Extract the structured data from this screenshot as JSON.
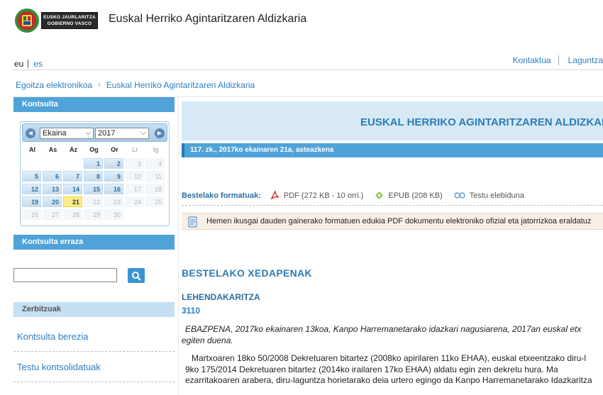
{
  "header": {
    "logo_line1": "EUSKO JAURLARITZA",
    "logo_line2": "GOBIERNO VASCO",
    "site_title": "Euskal Herriko Agintaritzaren Aldizkaria"
  },
  "languages": {
    "current": "eu",
    "other": "es"
  },
  "top_links": {
    "contact": "Kontaktua",
    "help": "Laguntza"
  },
  "breadcrumb": [
    "Egoitza elektronikoa",
    "Euskal Herriko Agintaritzaren Aldizkaria"
  ],
  "sidebar": {
    "consult_header": "Kontsulta",
    "calendar": {
      "month": "Ekaina",
      "year": "2017",
      "weekdays": [
        "Al",
        "As",
        "Az",
        "Og",
        "Or",
        "Lr",
        "Ig"
      ],
      "weeks": [
        [
          "",
          "",
          "",
          "1",
          "2",
          "3",
          "4"
        ],
        [
          "5",
          "6",
          "7",
          "8",
          "9",
          "10",
          "11"
        ],
        [
          "12",
          "13",
          "14",
          "15",
          "16",
          "17",
          "18"
        ],
        [
          "19",
          "20",
          "21",
          "22",
          "23",
          "24",
          "25"
        ],
        [
          "26",
          "27",
          "28",
          "29",
          "30",
          "",
          ""
        ]
      ],
      "selected_day": "21",
      "enabled_through": 21
    },
    "simple_header": "Kontsulta erraza",
    "search_value": "",
    "services_header": "Zerbitzuak",
    "links": [
      "Kontsulta berezia",
      "Testu kontsolidatuak"
    ]
  },
  "main": {
    "banner_title": "EUSKAL HERRIKO AGINTARITZAREN ALDIZKARIA",
    "issue": "117. zk., 2017ko ekainaren 21a, asteazkena",
    "formats_label": "Bestelako formatuak:",
    "formats": [
      {
        "label": "PDF (272 KB - 10 orri.)",
        "icon": "pdf-icon"
      },
      {
        "label": "EPUB (208 KB)",
        "icon": "epub-icon"
      },
      {
        "label": "Testu elebiduna",
        "icon": "bilingual-icon"
      }
    ],
    "notice": "Hemen ikusgai dauden gainerako formatuen edukia PDF dokumentu elektroniko ofizial eta jatorrizkoa eraldatuz",
    "section_title": "BESTELAKO XEDAPENAK",
    "department": "LEHENDAKARITZA",
    "doc_number": "3110",
    "paragraphs": [
      "EBAZPENA, 2017ko ekainaren 13koa, Kanpo Harremanetarako idazkari nagusiarena, 2017an euskal etx",
      "egiten duena.",
      "Martxoaren 18ko 50/2008 Dekretuaren bitartez (2008ko apirilaren 11ko EHAA), euskal etxeentzako diru-l",
      "9ko 175/2014 Dekretuaren bitartez (2014ko irailaren 17ko EHAA) aldatu egin zen dekretu hura. Ma",
      "ezarritakoaren arabera, diru-laguntza horietarako deia urtero egingo da Kanpo Harremanetarako Idazkaritza"
    ]
  },
  "colors": {
    "accent": "#4fa3d9",
    "link": "#2b7fc4",
    "banner_bg": "#d6e9f5",
    "today_bg": "#fbec88",
    "notice_bg": "#f7efe6"
  }
}
